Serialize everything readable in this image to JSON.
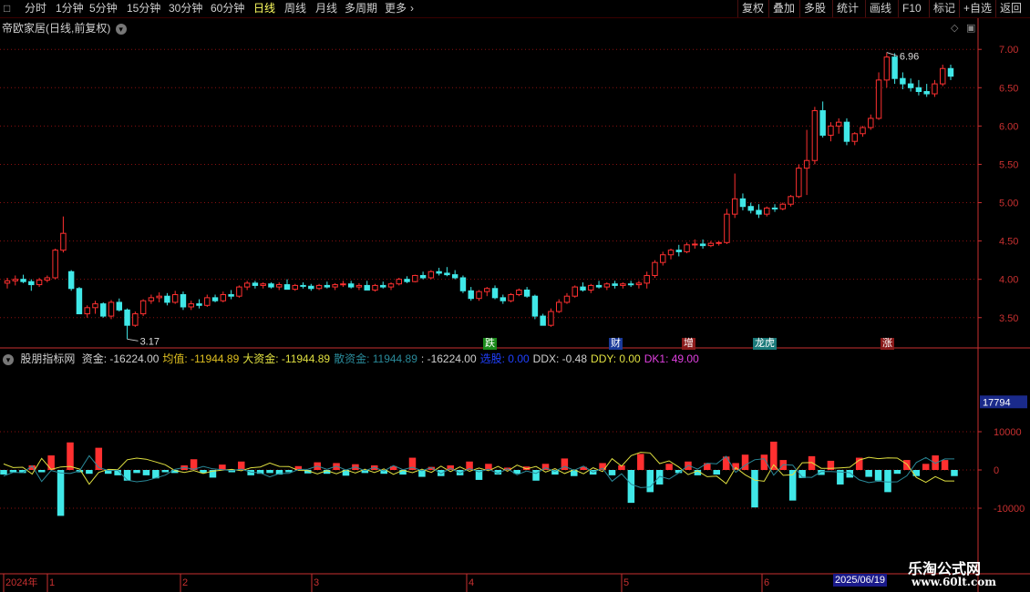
{
  "toolbar": {
    "left": [
      "分时",
      "1分钟",
      "5分钟",
      "15分钟",
      "30分钟",
      "60分钟",
      "日线",
      "周线",
      "月线",
      "多周期",
      "更多"
    ],
    "active": "日线",
    "right": [
      "复权",
      "叠加",
      "多股",
      "统计",
      "画线",
      "F10",
      "标记",
      "+自选",
      "返回"
    ]
  },
  "main_title": "帝欧家居(日线,前复权)",
  "price_axis": [
    "7.00",
    "6.50",
    "6.00",
    "5.50",
    "5.00",
    "4.50",
    "4.00",
    "3.50"
  ],
  "high_label": "6.96",
  "low_label": "3.17",
  "event_tags": [
    {
      "text": "跌",
      "color": "#1a8a1a"
    },
    {
      "text": "财",
      "color": "#1a3a9a"
    },
    {
      "text": "增",
      "color": "#8a1a1a"
    },
    {
      "text": "龙虎",
      "color": "#1a7a7a"
    },
    {
      "text": "涨",
      "color": "#8a1a1a"
    }
  ],
  "indicator": {
    "name": "股朋指标网",
    "fields": [
      {
        "text": "资金: -16224.00",
        "color": "#d0d0d0"
      },
      {
        "text": "均值: -11944.89",
        "color": "#e0c020"
      },
      {
        "text": "大资金: -11944.89",
        "color": "#e0e040"
      },
      {
        "text": "散资金: 11944.89",
        "color": "#2a8a9a"
      },
      {
        "text": ": -16224.00",
        "color": "#d0d0d0"
      },
      {
        "text": "选股: 0.00",
        "color": "#2040ff"
      },
      {
        "text": "DDX: -0.48",
        "color": "#d0d0d0"
      },
      {
        "text": "DDY: 0.00",
        "color": "#e0e040"
      },
      {
        "text": "DK1: 49.00",
        "color": "#e040e0"
      }
    ],
    "axis": [
      "10000",
      "0",
      "-10000"
    ],
    "current_value": "17794"
  },
  "time_axis": {
    "labels": [
      "2024年",
      "1",
      "2",
      "3",
      "4",
      "5",
      "6"
    ],
    "cursor_date": "2025/06/19"
  },
  "watermark": {
    "title": "乐淘公式网",
    "url": "www.60lt.com"
  },
  "colors": {
    "up": "#ff3030",
    "down": "#40e8e8",
    "grid": "#8a1010",
    "axis": "#c83030"
  },
  "chart_data": {
    "type": "candlestick",
    "ohlc": [
      [
        3.95,
        4.02,
        3.88,
        3.98
      ],
      [
        3.98,
        4.05,
        3.92,
        4.0
      ],
      [
        4.0,
        4.06,
        3.95,
        3.97
      ],
      [
        3.97,
        4.0,
        3.85,
        3.93
      ],
      [
        3.93,
        4.02,
        3.9,
        3.99
      ],
      [
        3.99,
        4.05,
        3.96,
        4.02
      ],
      [
        4.02,
        4.4,
        4.0,
        4.38
      ],
      [
        4.38,
        4.82,
        4.35,
        4.6
      ],
      [
        4.1,
        4.12,
        3.85,
        3.88
      ],
      [
        3.88,
        3.9,
        3.6,
        3.55
      ],
      [
        3.55,
        3.66,
        3.5,
        3.63
      ],
      [
        3.63,
        3.72,
        3.55,
        3.68
      ],
      [
        3.68,
        3.7,
        3.5,
        3.52
      ],
      [
        3.52,
        3.73,
        3.48,
        3.7
      ],
      [
        3.7,
        3.75,
        3.58,
        3.6
      ],
      [
        3.6,
        3.62,
        3.22,
        3.4
      ],
      [
        3.4,
        3.58,
        3.38,
        3.55
      ],
      [
        3.55,
        3.74,
        3.52,
        3.72
      ],
      [
        3.72,
        3.8,
        3.68,
        3.76
      ],
      [
        3.76,
        3.83,
        3.7,
        3.78
      ],
      [
        3.78,
        3.82,
        3.66,
        3.7
      ],
      [
        3.7,
        3.85,
        3.68,
        3.8
      ],
      [
        3.8,
        3.84,
        3.6,
        3.64
      ],
      [
        3.64,
        3.72,
        3.6,
        3.68
      ],
      [
        3.68,
        3.74,
        3.62,
        3.66
      ],
      [
        3.66,
        3.8,
        3.64,
        3.76
      ],
      [
        3.76,
        3.8,
        3.7,
        3.72
      ],
      [
        3.72,
        3.84,
        3.7,
        3.8
      ],
      [
        3.8,
        3.86,
        3.74,
        3.78
      ],
      [
        3.78,
        3.92,
        3.76,
        3.9
      ],
      [
        3.9,
        3.98,
        3.86,
        3.95
      ],
      [
        3.95,
        3.98,
        3.88,
        3.92
      ],
      [
        3.92,
        3.96,
        3.88,
        3.94
      ],
      [
        3.94,
        3.96,
        3.88,
        3.9
      ],
      [
        3.9,
        3.96,
        3.86,
        3.93
      ],
      [
        3.93,
        4.0,
        3.9,
        3.87
      ],
      [
        3.87,
        3.94,
        3.85,
        3.92
      ],
      [
        3.92,
        3.96,
        3.88,
        3.91
      ],
      [
        3.91,
        3.94,
        3.85,
        3.88
      ],
      [
        3.88,
        3.94,
        3.86,
        3.92
      ],
      [
        3.92,
        3.97,
        3.88,
        3.9
      ],
      [
        3.9,
        3.95,
        3.86,
        3.93
      ],
      [
        3.93,
        3.98,
        3.9,
        3.94
      ],
      [
        3.94,
        3.98,
        3.88,
        3.9
      ],
      [
        3.9,
        3.95,
        3.86,
        3.92
      ],
      [
        3.92,
        3.98,
        3.9,
        3.86
      ],
      [
        3.86,
        3.94,
        3.84,
        3.92
      ],
      [
        3.92,
        3.97,
        3.88,
        3.9
      ],
      [
        3.9,
        3.96,
        3.86,
        3.94
      ],
      [
        3.94,
        4.02,
        3.92,
        4.0
      ],
      [
        4.0,
        4.04,
        3.95,
        3.97
      ],
      [
        3.97,
        4.06,
        3.96,
        4.05
      ],
      [
        4.05,
        4.1,
        4.0,
        4.02
      ],
      [
        4.02,
        4.12,
        4.0,
        4.1
      ],
      [
        4.1,
        4.15,
        4.05,
        4.08
      ],
      [
        4.08,
        4.16,
        4.04,
        4.06
      ],
      [
        4.06,
        4.12,
        4.0,
        4.02
      ],
      [
        4.02,
        4.05,
        3.82,
        3.85
      ],
      [
        3.85,
        3.9,
        3.72,
        3.75
      ],
      [
        3.75,
        3.86,
        3.72,
        3.84
      ],
      [
        3.84,
        3.9,
        3.78,
        3.88
      ],
      [
        3.88,
        3.92,
        3.74,
        3.76
      ],
      [
        3.76,
        3.8,
        3.68,
        3.72
      ],
      [
        3.72,
        3.82,
        3.7,
        3.8
      ],
      [
        3.8,
        3.88,
        3.78,
        3.86
      ],
      [
        3.86,
        3.9,
        3.76,
        3.78
      ],
      [
        3.78,
        3.8,
        3.48,
        3.52
      ],
      [
        3.52,
        3.55,
        3.4,
        3.4
      ],
      [
        3.4,
        3.62,
        3.38,
        3.58
      ],
      [
        3.58,
        3.74,
        3.56,
        3.7
      ],
      [
        3.7,
        3.82,
        3.68,
        3.78
      ],
      [
        3.78,
        3.92,
        3.76,
        3.9
      ],
      [
        3.9,
        3.96,
        3.84,
        3.86
      ],
      [
        3.86,
        3.94,
        3.82,
        3.92
      ],
      [
        3.92,
        3.98,
        3.88,
        3.9
      ],
      [
        3.9,
        3.96,
        3.86,
        3.94
      ],
      [
        3.94,
        3.98,
        3.88,
        3.92
      ],
      [
        3.92,
        3.96,
        3.88,
        3.94
      ],
      [
        3.94,
        3.98,
        3.9,
        3.93
      ],
      [
        3.93,
        3.98,
        3.88,
        3.95
      ],
      [
        3.95,
        4.1,
        3.88,
        4.05
      ],
      [
        4.05,
        4.25,
        4.02,
        4.22
      ],
      [
        4.22,
        4.36,
        4.18,
        4.32
      ],
      [
        4.32,
        4.4,
        4.26,
        4.38
      ],
      [
        4.38,
        4.45,
        4.3,
        4.36
      ],
      [
        4.36,
        4.48,
        4.34,
        4.45
      ],
      [
        4.45,
        4.52,
        4.4,
        4.46
      ],
      [
        4.46,
        4.52,
        4.4,
        4.44
      ],
      [
        4.44,
        4.5,
        4.42,
        4.47
      ],
      [
        4.47,
        4.5,
        4.44,
        4.48
      ],
      [
        4.48,
        4.92,
        4.46,
        4.85
      ],
      [
        4.85,
        5.38,
        4.8,
        5.05
      ],
      [
        5.05,
        5.12,
        4.9,
        4.95
      ],
      [
        4.95,
        5.0,
        4.86,
        4.9
      ],
      [
        4.9,
        4.98,
        4.8,
        4.85
      ],
      [
        4.85,
        4.95,
        4.82,
        4.93
      ],
      [
        4.93,
        4.98,
        4.88,
        4.92
      ],
      [
        4.92,
        5.0,
        4.9,
        4.98
      ],
      [
        4.98,
        5.1,
        4.95,
        5.08
      ],
      [
        5.08,
        5.5,
        5.06,
        5.45
      ],
      [
        5.45,
        5.95,
        5.1,
        5.55
      ],
      [
        5.55,
        6.25,
        5.5,
        6.2
      ],
      [
        6.2,
        6.32,
        5.85,
        5.88
      ],
      [
        5.88,
        6.05,
        5.8,
        6.0
      ],
      [
        6.0,
        6.1,
        5.9,
        6.05
      ],
      [
        6.05,
        6.1,
        5.75,
        5.8
      ],
      [
        5.8,
        5.92,
        5.75,
        5.9
      ],
      [
        5.9,
        6.0,
        5.86,
        5.98
      ],
      [
        5.98,
        6.15,
        5.95,
        6.1
      ],
      [
        6.1,
        6.7,
        6.08,
        6.6
      ],
      [
        6.6,
        6.96,
        6.5,
        6.9
      ],
      [
        6.9,
        6.95,
        6.55,
        6.62
      ],
      [
        6.62,
        6.7,
        6.48,
        6.55
      ],
      [
        6.55,
        6.62,
        6.45,
        6.5
      ],
      [
        6.5,
        6.6,
        6.4,
        6.45
      ],
      [
        6.45,
        6.55,
        6.38,
        6.42
      ],
      [
        6.42,
        6.6,
        6.38,
        6.55
      ],
      [
        6.55,
        6.8,
        6.52,
        6.75
      ],
      [
        6.75,
        6.8,
        6.6,
        6.65
      ]
    ],
    "ylim": [
      3.2,
      7.05
    ],
    "indicator_series": [
      {
        "type": "bar",
        "values": [
          -1200,
          -600,
          -800,
          1200,
          -600,
          3800,
          -12000,
          7200,
          -600,
          -1000,
          5800,
          -1000,
          -1400,
          -2800,
          -800,
          -1400,
          -2200,
          -600,
          -800,
          1200,
          2800,
          -800,
          -2000,
          1400,
          -600,
          2200,
          -1400,
          -1000,
          -800,
          -1200,
          -600,
          1000,
          -900,
          2000,
          -1000,
          1800,
          -1500,
          1500,
          -800,
          1200,
          -1000,
          1000,
          -1200,
          3200,
          -1800,
          800,
          -1600,
          1200,
          -1400,
          2200,
          -2600,
          1600,
          -1200,
          600,
          -1000,
          900,
          -2800,
          1600,
          -1200,
          3000,
          -1600,
          800,
          -1200,
          1800,
          -1400,
          1200,
          -8600,
          4200,
          -5800,
          -3800,
          1600,
          -800,
          2200,
          -1400,
          1800,
          -1200,
          3500,
          1800,
          4000,
          -9800,
          4000,
          7400,
          2600,
          -8000,
          -2100,
          3600,
          -1300,
          2400,
          -3800,
          -2000,
          3200,
          -1800,
          -2800,
          -5800,
          -1000,
          2600,
          -1600,
          1600,
          3800,
          2600,
          -1600
        ]
      },
      {
        "type": "line",
        "name": "大资金",
        "color": "#e0e040"
      },
      {
        "type": "line",
        "name": "散资金",
        "color": "#2a8a9a"
      }
    ]
  }
}
